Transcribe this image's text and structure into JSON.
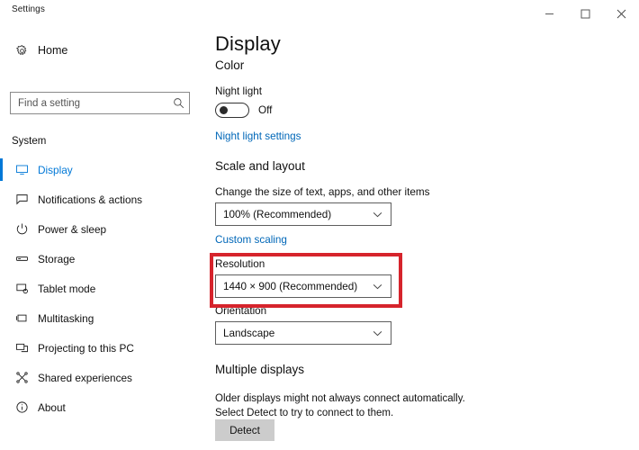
{
  "window": {
    "title": "Settings",
    "controls": {
      "minimize": "minimize",
      "maximize": "maximize",
      "close": "close"
    }
  },
  "sidebar": {
    "home_label": "Home",
    "search": {
      "placeholder": "Find a setting",
      "value": ""
    },
    "group_header": "System",
    "items": [
      {
        "label": "Display",
        "icon": "monitor-icon",
        "selected": true
      },
      {
        "label": "Notifications & actions",
        "icon": "notification-icon",
        "selected": false
      },
      {
        "label": "Power & sleep",
        "icon": "power-icon",
        "selected": false
      },
      {
        "label": "Storage",
        "icon": "storage-icon",
        "selected": false
      },
      {
        "label": "Tablet mode",
        "icon": "tablet-icon",
        "selected": false
      },
      {
        "label": "Multitasking",
        "icon": "multitasking-icon",
        "selected": false
      },
      {
        "label": "Projecting to this PC",
        "icon": "projecting-icon",
        "selected": false
      },
      {
        "label": "Shared experiences",
        "icon": "shared-icon",
        "selected": false
      },
      {
        "label": "About",
        "icon": "info-icon",
        "selected": false
      }
    ]
  },
  "main": {
    "page_title": "Display",
    "color_section": {
      "title": "Color",
      "night_light_label": "Night light",
      "night_light_state": "Off",
      "night_light_settings_link": "Night light settings"
    },
    "scale_section": {
      "title": "Scale and layout",
      "scale_label": "Change the size of text, apps, and other items",
      "scale_value": "100% (Recommended)",
      "custom_scaling_link": "Custom scaling",
      "resolution_label": "Resolution",
      "resolution_value": "1440 × 900 (Recommended)",
      "orientation_label": "Orientation",
      "orientation_value": "Landscape"
    },
    "multiple_displays": {
      "title": "Multiple displays",
      "description": "Older displays might not always connect automatically. Select Detect to try to connect to them.",
      "detect_button": "Detect"
    }
  },
  "annotation": {
    "highlight_color": "#d6242c",
    "target": "Resolution"
  },
  "colors": {
    "accent": "#0078d7",
    "link": "#0067b8",
    "background": "#ffffff"
  }
}
